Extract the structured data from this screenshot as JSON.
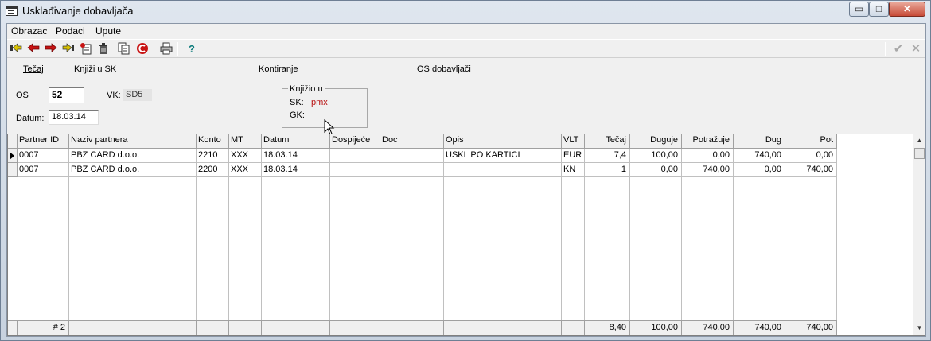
{
  "window": {
    "title": "Usklađivanje dobavljača",
    "controls": {
      "minimize": "▭",
      "maximize": "□",
      "close": "✕"
    }
  },
  "menu": {
    "items": [
      "Obrazac",
      "Podaci",
      "Upute"
    ]
  },
  "toolbar": {
    "icons": [
      "first-record-icon",
      "previous-record-icon",
      "next-record-icon",
      "last-record-icon",
      "new-record-icon",
      "delete-icon",
      "copy-icon",
      "refresh-icon",
      "print-icon",
      "help-icon"
    ],
    "confirm_label": "✔",
    "cancel_label": "✕"
  },
  "actions": {
    "tecaj": "Tečaj",
    "knjizi_u_sk": "Knjiži u SK",
    "kontiranje": "Kontiranje",
    "os_dobavljaci": "OS dobavljači"
  },
  "form": {
    "os_label": "OS",
    "os_value": "52",
    "vk_label": "VK:",
    "vk_value": "SD5",
    "datum_label": "Datum:",
    "datum_value": "18.03.14"
  },
  "knjizio": {
    "title": "Knjižio u",
    "sk_label": "SK:",
    "sk_value": "pmx",
    "gk_label": "GK:",
    "gk_value": ""
  },
  "grid": {
    "columns": [
      "Partner ID",
      "Naziv partnera",
      "Konto",
      "MT",
      "Datum",
      "Dospijeće",
      "Doc",
      "Opis",
      "VLT",
      "Tečaj",
      "Duguje",
      "Potražuje",
      "Dug",
      "Pot"
    ],
    "rows": [
      [
        "0007",
        "PBZ CARD d.o.o.",
        "2210",
        "XXX",
        "18.03.14",
        "",
        "",
        "USKL PO KARTICI",
        "EUR",
        "7,4",
        "100,00",
        "0,00",
        "740,00",
        "0,00"
      ],
      [
        "0007",
        "PBZ CARD d.o.o.",
        "2200",
        "XXX",
        "18.03.14",
        "",
        "",
        "",
        "KN",
        "1",
        "0,00",
        "740,00",
        "0,00",
        "740,00"
      ]
    ],
    "footer": {
      "count": "# 2",
      "tecaj": "8,40",
      "duguje": "100,00",
      "potrazuje": "740,00",
      "dug": "740,00",
      "pot": "740,00"
    }
  },
  "colors": {
    "accent_red": "#b81010",
    "help_teal": "#0a7a7a",
    "title_bg": "#d7e0ea"
  }
}
